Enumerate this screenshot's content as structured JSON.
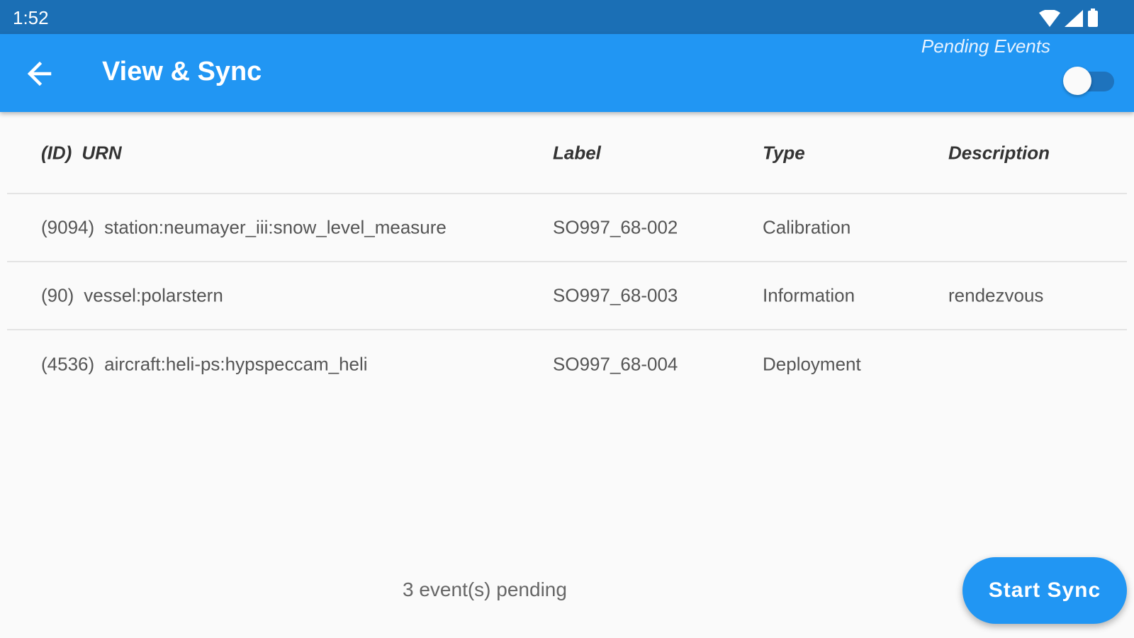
{
  "status_bar": {
    "time": "1:52",
    "icons": [
      "wifi-icon",
      "signal-icon",
      "battery-icon"
    ]
  },
  "app_bar": {
    "title": "View & Sync",
    "back_icon": "arrow-left-icon",
    "toggle_label": "Pending Events",
    "toggle_on": false,
    "color": "#2196f3"
  },
  "table": {
    "headers": {
      "id": "(ID)",
      "urn": "URN",
      "label": "Label",
      "type": "Type",
      "description": "Description"
    },
    "rows": [
      {
        "id": "(9094)",
        "urn": "station:neumayer_iii:snow_level_measure",
        "label": "SO997_68-002",
        "type": "Calibration",
        "description": ""
      },
      {
        "id": "(90)",
        "urn": "vessel:polarstern",
        "label": "SO997_68-003",
        "type": "Information",
        "description": "rendezvous"
      },
      {
        "id": "(4536)",
        "urn": "aircraft:heli-ps:hypspeccam_heli",
        "label": "SO997_68-004",
        "type": "Deployment",
        "description": ""
      }
    ]
  },
  "footer": {
    "pending_text": "3 event(s) pending",
    "sync_button": "Start Sync"
  }
}
